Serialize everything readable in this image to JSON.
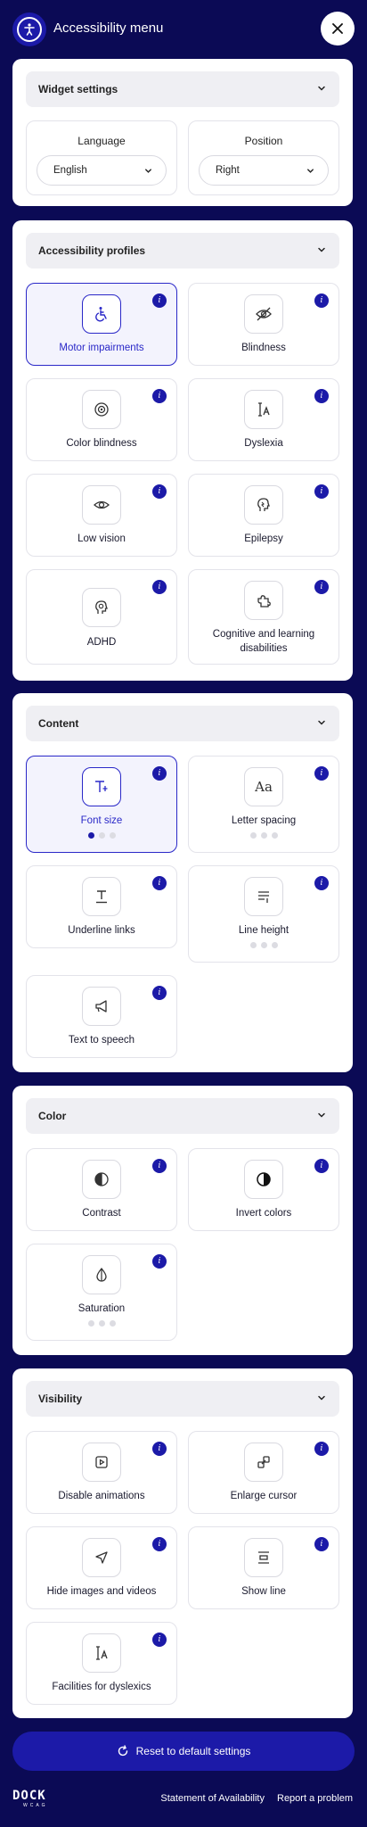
{
  "header": {
    "title": "Accessibility menu"
  },
  "widget_settings": {
    "label": "Widget settings",
    "language": {
      "caption": "Language",
      "value": "English"
    },
    "position": {
      "caption": "Position",
      "value": "Right"
    }
  },
  "profiles": {
    "label": "Accessibility profiles",
    "items": [
      {
        "name": "Motor impairments",
        "icon": "wheelchair-icon",
        "active": true
      },
      {
        "name": "Blindness",
        "icon": "eye-off-icon",
        "active": false
      },
      {
        "name": "Color blindness",
        "icon": "color-blind-icon",
        "active": false
      },
      {
        "name": "Dyslexia",
        "icon": "text-cursor-icon",
        "active": false
      },
      {
        "name": "Low vision",
        "icon": "eye-icon",
        "active": false
      },
      {
        "name": "Epilepsy",
        "icon": "head-icon",
        "active": false
      },
      {
        "name": "ADHD",
        "icon": "brain-icon",
        "active": false
      },
      {
        "name": "Cognitive and learning disabilities",
        "icon": "puzzle-icon",
        "active": false
      }
    ]
  },
  "content": {
    "label": "Content",
    "items": [
      {
        "name": "Font size",
        "icon": "font-size-icon",
        "active": true,
        "level": 1,
        "levels": 3
      },
      {
        "name": "Letter spacing",
        "icon": "letter-spacing-icon",
        "active": false,
        "level": 0,
        "levels": 3
      },
      {
        "name": "Underline links",
        "icon": "underline-icon",
        "active": false
      },
      {
        "name": "Line height",
        "icon": "line-height-icon",
        "active": false,
        "level": 0,
        "levels": 3
      },
      {
        "name": "Text to speech",
        "icon": "megaphone-icon",
        "active": false
      }
    ]
  },
  "color": {
    "label": "Color",
    "items": [
      {
        "name": "Contrast",
        "icon": "contrast-icon",
        "active": false
      },
      {
        "name": "Invert colors",
        "icon": "invert-icon",
        "active": false
      },
      {
        "name": "Saturation",
        "icon": "drop-icon",
        "active": false,
        "level": 0,
        "levels": 3
      }
    ]
  },
  "visibility": {
    "label": "Visibility",
    "items": [
      {
        "name": "Disable animations",
        "icon": "play-icon",
        "active": false
      },
      {
        "name": "Enlarge cursor",
        "icon": "cursor-icon",
        "active": false
      },
      {
        "name": "Hide images and videos",
        "icon": "pointer-icon",
        "active": false
      },
      {
        "name": "Show line",
        "icon": "line-icon",
        "active": false
      },
      {
        "name": "Facilities for dyslexics",
        "icon": "text-cursor-icon",
        "active": false
      }
    ]
  },
  "reset": {
    "label": "Reset to default settings"
  },
  "footer": {
    "logo_main": "DOCK",
    "logo_sub": "WCAG",
    "link_availability": "Statement of Availability",
    "link_report": "Report a problem"
  },
  "colors": {
    "background": "#0b0a55",
    "accent": "#1c1aa8"
  }
}
